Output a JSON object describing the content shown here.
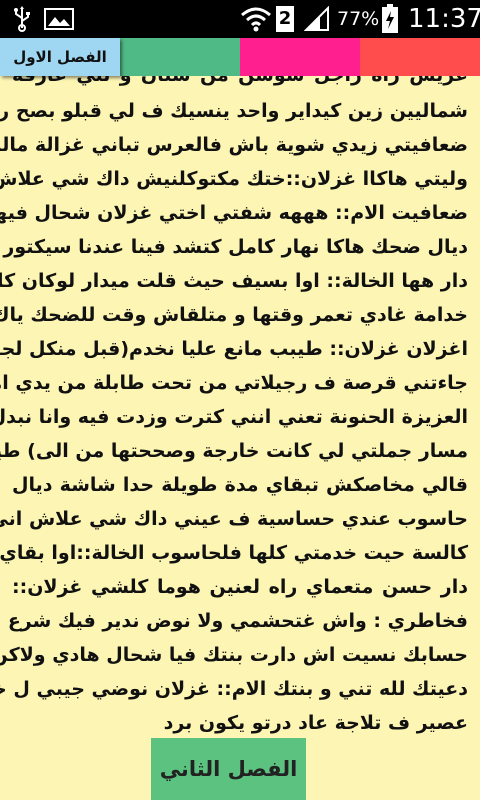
{
  "status_bar": {
    "battery_percent": "77%",
    "time": "11:37",
    "sim_badge": "2",
    "icons": [
      "usb-icon",
      "image-icon",
      "wifi-icon",
      "signal-icon",
      "battery-charging-icon"
    ]
  },
  "tabs": [
    {
      "label": "الفصل الاول",
      "color": "#9fd6f2",
      "active": true
    },
    {
      "label": "",
      "color": "#4fba86",
      "active": false
    },
    {
      "label": "",
      "color": "#ff1f8e",
      "active": false
    },
    {
      "label": "",
      "color": "#ff4d4d",
      "active": false
    }
  ],
  "story": {
    "lines": [
      "عريس راه راجل سوسن من سنان و تني عارقة",
      "شماليين زين كيداير واحد ينسيك ف لي قبلو بصح راك",
      "ضعافيتي زيدي شوية باش فالعرس تباني غزالة مالك",
      "وليتي هاكاا غزلان::ختك مكتوكلنيش داك شي علاش",
      "ضعافيت الام:: هههه شفتي اختي غزلان شحال فيها",
      "ديال ضحك هاكا نهار كامل كتشد فينا عندنا سيكتور ف",
      "دار هها الخالة:: اوا بسيف حيث قلت ميدار لوكان كانت",
      "خدامة غادي تعمر وقتها و متلقاش وقت للضحك ياك",
      "اغزلان غزلان:: طيبب مانع عليا نخدم(قبل منكل لجملة",
      "جاءتني قرصة ف رجيلاتي من تحت طابلة من يدي امي",
      "العزيزة الحنونة تعني انني كترت وزدت فيه وانا نبدل",
      "مسار جملتي لي كانت خارجة وصححتها من الى) طيبب",
      "قالي مخاصكش تبقاي مدة طويلة حدا شاشة ديال",
      "حاسوب عندي حساسية ف عيني داك شي علاش اني",
      "كالسة حيت خدمتي كلها فلحاسوب الخالة::اوا بقاي ف",
      "دار حسن متعماي راه لعنين هوما كلشي غزلان::",
      "فخاطري : واش غتحشمي ولا نوض ندير فيك شرع يديا",
      "حسابك نسيت اش دارت بنتك فيا شحال هادي ولاكن",
      "دعيتك لله تني و بنتك الام:: غزلان نوضي جيبي ل خالتك",
      "عصير ف تلاجة عاد درتو يكون برد"
    ]
  },
  "next_button": {
    "label": "الفصل الثاني"
  }
}
